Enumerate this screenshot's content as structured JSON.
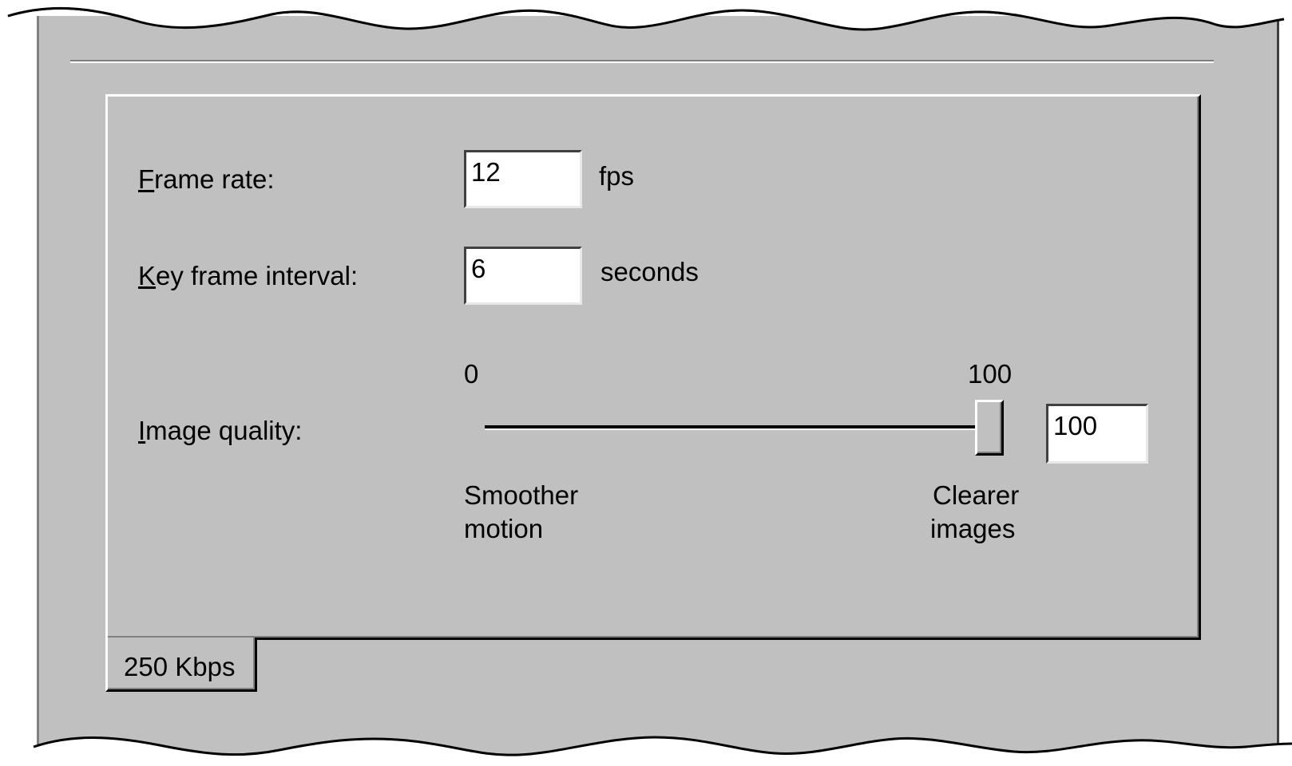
{
  "tab": {
    "label": "250 Kbps"
  },
  "frame_rate": {
    "label_mnemonic": "F",
    "label_rest": "rame rate:",
    "value": "12",
    "unit": "fps"
  },
  "key_frame": {
    "label_mnemonic": "K",
    "label_rest": "ey frame interval:",
    "value": "6",
    "unit": "seconds"
  },
  "image_quality": {
    "label_mnemonic": "I",
    "label_rest": "mage quality:",
    "min_label": "0",
    "max_label": "100",
    "slider_value": 100,
    "value": "100",
    "left_caption_line1": "Smoother",
    "left_caption_line2": "motion",
    "right_caption_line1": "Clearer",
    "right_caption_line2": "images"
  },
  "colors": {
    "face": "#c0c0c0",
    "highlight": "#ffffff",
    "shadow": "#808080",
    "dark_shadow": "#000000"
  }
}
